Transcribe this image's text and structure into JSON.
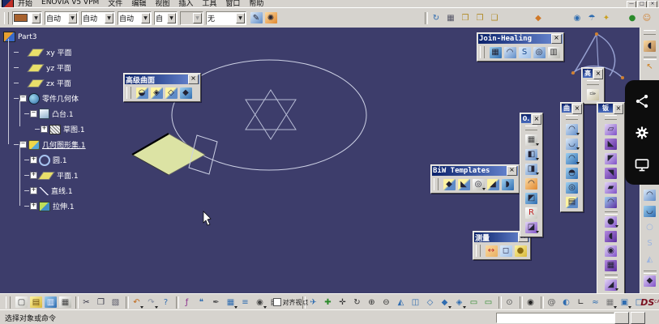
{
  "app": {
    "close_glyph": "×",
    "dropdown_glyph": "▼",
    "viewport_bg": "#3d3d6b",
    "chrome_bg": "#d6d3ce",
    "title_bar_color": "#0a216a",
    "pad_fill": "#dce3a4",
    "tree_text": "#ffffff"
  },
  "menubar": {
    "items": [
      {
        "name": "menu-start",
        "label": "开始"
      },
      {
        "name": "menu-enovia",
        "label": "ENOVIA V5 VPM"
      },
      {
        "name": "menu-file",
        "label": "文件"
      },
      {
        "name": "menu-edit",
        "label": "编辑"
      },
      {
        "name": "menu-view",
        "label": "视图"
      },
      {
        "name": "menu-insert",
        "label": "插入"
      },
      {
        "name": "menu-tools",
        "label": "工具"
      },
      {
        "name": "menu-window",
        "label": "窗口"
      },
      {
        "name": "menu-help",
        "label": "帮助"
      }
    ],
    "controls": [
      {
        "name": "minimize-button",
        "glyph": "—"
      },
      {
        "name": "maximize-button",
        "glyph": "□"
      },
      {
        "name": "close-button",
        "glyph": "×"
      }
    ]
  },
  "format_bar": {
    "combos": [
      {
        "name": "color-combo",
        "value": "",
        "size": "c",
        "swatch": "#a8622e"
      },
      {
        "name": "linetype-combo",
        "value": "自动"
      },
      {
        "name": "lineweight-combo",
        "value": "自动"
      },
      {
        "name": "pointtype-combo",
        "value": "自动"
      },
      {
        "name": "render-combo",
        "value": "自",
        "size": "s"
      },
      {
        "name": "disabled-combo",
        "value": "",
        "size": "s",
        "disabled": true
      },
      {
        "name": "layer-filter-combo",
        "value": "无",
        "size": "l"
      }
    ],
    "tools": [
      {
        "name": "paint-attributes-icon",
        "glyph": "✎",
        "bg": "linear-gradient(135deg,#dce9f8,#5f8cc8)"
      },
      {
        "name": "color-wand-icon",
        "glyph": "✺",
        "bg": "linear-gradient(135deg,#fcd9a0,#e08830)"
      }
    ],
    "right_icons": [
      {
        "name": "update-links-icon",
        "glyph": "↻",
        "fg": "#2f6cb0",
        "sep": true
      },
      {
        "name": "grid-snap-icon",
        "glyph": "▦",
        "fg": "#556"
      },
      {
        "name": "catalog-copy-icon",
        "glyph": "❒",
        "fg": "#b08820"
      },
      {
        "name": "catalog-open-icon",
        "glyph": "❐",
        "fg": "#b08820"
      },
      {
        "name": "catalog-save-icon",
        "glyph": "❑",
        "fg": "#b08820"
      },
      {
        "name": "material-basket-icon",
        "glyph": "◆",
        "fg": "#d07828",
        "ml": 36
      },
      {
        "name": "eye-icon",
        "glyph": "◉",
        "fg": "#2f6cb0",
        "ml": 30
      },
      {
        "name": "parasol-icon",
        "glyph": "☂",
        "fg": "#2f6cb0"
      },
      {
        "name": "desk-lamp-icon",
        "glyph": "✦",
        "fg": "#caa020"
      },
      {
        "name": "globe-icon",
        "glyph": "●",
        "fg": "#2a8a2a",
        "ml": 14
      },
      {
        "name": "avatar-icon",
        "glyph": "☺",
        "fg": "#d08030"
      }
    ]
  },
  "tree": {
    "items": [
      {
        "name": "tree-item-part3",
        "label": "Part3",
        "depth": 0,
        "icon": "part"
      },
      {
        "name": "tree-item-xy-plane",
        "label": "xy 平面",
        "depth": 1,
        "icon": "plane"
      },
      {
        "name": "tree-item-yz-plane",
        "label": "yz 平面",
        "depth": 1,
        "icon": "plane"
      },
      {
        "name": "tree-item-zx-plane",
        "label": "zx 平面",
        "depth": 1,
        "icon": "plane"
      },
      {
        "name": "tree-item-partbody",
        "label": "零件几何体",
        "depth": 1,
        "icon": "body",
        "exp": "minus"
      },
      {
        "name": "tree-item-pad1",
        "label": "凸台.1",
        "depth": 2,
        "icon": "pad",
        "exp": "minus"
      },
      {
        "name": "tree-item-sketch1",
        "label": "草图.1",
        "depth": 3,
        "icon": "sketch",
        "exp": "plus"
      },
      {
        "name": "tree-item-geoset1",
        "label": "几何图形集.1",
        "depth": 1,
        "icon": "geoset",
        "exp": "minus",
        "underline": true
      },
      {
        "name": "tree-item-circle1",
        "label": "圆.1",
        "depth": 2,
        "icon": "circle",
        "exp": "plus"
      },
      {
        "name": "tree-item-plane1",
        "label": "平面.1",
        "depth": 2,
        "icon": "plane",
        "exp": "plus"
      },
      {
        "name": "tree-item-line1",
        "label": "直线.1",
        "depth": 2,
        "icon": "line",
        "exp": "plus"
      },
      {
        "name": "tree-item-extrude1",
        "label": "拉伸.1",
        "depth": 2,
        "icon": "extrude",
        "exp": "plus"
      }
    ]
  },
  "toolbars": {
    "advanced_surface": {
      "title": "高级曲面",
      "icons": [
        {
          "name": "bump-surface-icon",
          "glyph": "◒",
          "bg": "linear-gradient(135deg,#fdf3a0 45%,#5f8cc8 55%)"
        },
        {
          "name": "wrap-curve-icon",
          "glyph": "◈",
          "bg": "linear-gradient(135deg,#fdf3a0 45%,#5f8cc8 55%)"
        },
        {
          "name": "wrap-surface-icon",
          "glyph": "◇",
          "bg": "linear-gradient(135deg,#fdf3a0 45%,#5f8cc8 55%)"
        },
        {
          "name": "shape-morphing-icon",
          "glyph": "◆",
          "bg": "linear-gradient(135deg,#9fd0f0,#2f6cb0)"
        }
      ]
    },
    "join_healing": {
      "title": "Join-Healing",
      "icons": [
        {
          "name": "join-icon",
          "glyph": "▦",
          "bg": "linear-gradient(135deg,#9fd0f0,#2f6cb0)"
        },
        {
          "name": "healing-icon",
          "glyph": "◠",
          "bg": "linear-gradient(135deg,#dce9f8,#5f8cc8)"
        },
        {
          "name": "curve-smooth-icon",
          "glyph": "S",
          "fg": "#1c4c90",
          "bg": "linear-gradient(135deg,#dce9f8,#9fc0e8)"
        },
        {
          "name": "untrim-icon",
          "glyph": "◎",
          "bg": "linear-gradient(135deg,#dce9f8,#5f8cc8)"
        },
        {
          "name": "disassemble-icon",
          "glyph": "▥",
          "fg": "#333",
          "bg": "linear-gradient(135deg,#ffffff,#b8b8b0)"
        }
      ]
    },
    "biw_templates": {
      "title": "BiW Templates",
      "icons": [
        {
          "name": "junction-icon",
          "glyph": "◆",
          "bg": "linear-gradient(135deg,#fdf3a0 45%,#5f8cc8 55%)"
        },
        {
          "name": "diabolo-icon",
          "glyph": "◣",
          "bg": "linear-gradient(135deg,#fdf3a0 45%,#5f8cc8 55%)"
        },
        {
          "name": "hole-icon",
          "glyph": "◎",
          "bg": "linear-gradient(135deg,#ffffff,#b8b8b0)",
          "dd": true
        },
        {
          "name": "mating-flange-icon",
          "glyph": "◢",
          "bg": "linear-gradient(135deg,#fdf3a0 45%,#5f8cc8 55%)"
        },
        {
          "name": "bead-icon",
          "glyph": "◗",
          "bg": "linear-gradient(135deg,#9fd0f0,#2f6cb0)"
        }
      ]
    },
    "measure": {
      "title": "测量",
      "icons": [
        {
          "name": "measure-between-icon",
          "glyph": "↔",
          "fg": "#c03030",
          "bg": "linear-gradient(135deg,#fcd9a0,#e8b060)"
        },
        {
          "name": "measure-item-icon",
          "glyph": "◻",
          "fg": "#335",
          "bg": "linear-gradient(135deg,#dce9f8,#9fc0e8)"
        },
        {
          "name": "measure-inertia-icon",
          "glyph": "●",
          "fg": "#8a6a10",
          "bg": "linear-gradient(135deg,#fdf3a0,#d8b83a)"
        }
      ]
    },
    "gao": {
      "title": "高",
      "icons": [
        {
          "name": "advanced-feature-icon",
          "glyph": "✑",
          "fg": "#555",
          "bg": "linear-gradient(135deg,#ffffff,#c8c0a0)"
        }
      ]
    },
    "vt0": {
      "title": "0.",
      "icons": [
        {
          "name": "wireframe-grid-icon",
          "glyph": "▦",
          "fg": "#444",
          "bg": "linear-gradient(135deg,#ffffff,#b8b8b0)",
          "dd": true
        },
        {
          "name": "paint-surface-icon",
          "glyph": "◧",
          "bg": "linear-gradient(135deg,#dce9f8,#5f8cc8)",
          "dd": true
        },
        {
          "name": "extract-solid-icon",
          "glyph": "◨",
          "bg": "linear-gradient(135deg,#dce9f8,#5f8cc8)",
          "dd": true
        },
        {
          "name": "dome-surface-icon",
          "glyph": "◠",
          "bg": "linear-gradient(135deg,#fcd9a0,#e08830)"
        },
        {
          "name": "split-trim-icon",
          "glyph": "◩",
          "bg": "linear-gradient(135deg,#9fd0f0,#2f6cb0)"
        },
        {
          "name": "radius-fillet-icon",
          "glyph": "R",
          "fg": "#c02020",
          "bg": "linear-gradient(135deg,#ffffff,#c8c8c0)"
        },
        {
          "name": "transform-surface-icon",
          "glyph": "◪",
          "bg": "linear-gradient(135deg,#e2d4f5,#8052c8)",
          "dd": true
        }
      ]
    },
    "vtq": {
      "title": "曲",
      "icons": [
        {
          "name": "sweep-surface-icon",
          "glyph": "◠",
          "bg": "linear-gradient(135deg,#dce9f8,#5f8cc8)",
          "dd": true
        },
        {
          "name": "revolve-surface-icon",
          "glyph": "◡",
          "bg": "linear-gradient(135deg,#dce9f8,#5f8cc8)",
          "dd": true
        },
        {
          "name": "offset-surface-icon",
          "glyph": "◠",
          "bg": "linear-gradient(135deg,#9fd0f0,#2f6cb0)",
          "dd": true
        },
        {
          "name": "dome-icon",
          "glyph": "◓",
          "bg": "linear-gradient(135deg,#9fd0f0,#2f6cb0)"
        },
        {
          "name": "ring-surface-icon",
          "glyph": "◎",
          "bg": "linear-gradient(135deg,#9fd0f0,#2f6cb0)"
        },
        {
          "name": "multi-section-icon",
          "glyph": "▤",
          "bg": "linear-gradient(135deg,#fdf3a0 45%,#5f8cc8 55%)"
        }
      ]
    },
    "vtb": {
      "title": "钣",
      "icons": [
        {
          "name": "wall-icon",
          "glyph": "▱",
          "bg": "linear-gradient(135deg,#e2d4f5,#8052c8)"
        },
        {
          "name": "side-wall-icon",
          "glyph": "◣",
          "bg": "linear-gradient(135deg,#b48ae0,#5c2ea0)"
        },
        {
          "name": "flange-icon",
          "glyph": "◤",
          "bg": "linear-gradient(135deg,#e2d4f5,#8052c8)"
        },
        {
          "name": "hem-icon",
          "glyph": "◥",
          "bg": "linear-gradient(135deg,#b48ae0,#5c2ea0)"
        },
        {
          "name": "swept-wall-icon",
          "glyph": "▰",
          "bg": "linear-gradient(135deg,#e2d4f5,#8052c8)"
        },
        {
          "name": "rolled-wall-icon",
          "glyph": "◠",
          "bg": "linear-gradient(135deg,#9fd0f0,#5c2ea0)"
        },
        {
          "name": "stamp-icon",
          "glyph": "●",
          "bg": "linear-gradient(135deg,#e2d4f5,#8052c8)",
          "dd": true,
          "sep": true
        },
        {
          "name": "louver-icon",
          "glyph": "◖",
          "bg": "linear-gradient(135deg,#b48ae0,#5c2ea0)"
        },
        {
          "name": "flanged-hole-icon",
          "glyph": "◉",
          "bg": "linear-gradient(135deg,#e2d4f5,#8052c8)"
        },
        {
          "name": "pattern-icon",
          "glyph": "▦",
          "bg": "linear-gradient(135deg,#b48ae0,#5c2ea0)"
        },
        {
          "name": "corner-relief-icon",
          "glyph": "◢",
          "bg": "linear-gradient(135deg,#e2d4f5,#8052c8)",
          "dd": true,
          "sep": true
        }
      ]
    },
    "right_dock": {
      "icons": [
        {
          "name": "render-tools-icon",
          "glyph": "◖",
          "bg": "linear-gradient(135deg,#fcd9a0,#b08050)"
        },
        {
          "name": "select-arrow-icon",
          "glyph": "↖",
          "fg": "#d08020",
          "sep": true
        },
        {
          "name": "dock-gap",
          "gap": 135
        },
        {
          "name": "surface-sweep-icon",
          "glyph": "◠",
          "bg": "linear-gradient(135deg,#dce9f8,#5f8cc8)"
        },
        {
          "name": "surface-loft-icon",
          "glyph": "◡",
          "bg": "linear-gradient(135deg,#9fd0f0,#2f6cb0)"
        },
        {
          "name": "circle-tool-icon",
          "glyph": "○",
          "fg": "#9ab4e0"
        },
        {
          "name": "spline-tool-icon",
          "glyph": "S",
          "fg": "#9ab4e0"
        },
        {
          "name": "plane-tool-icon",
          "glyph": "◭",
          "fg": "#9ab4e0"
        },
        {
          "name": "extrude-surface-icon",
          "glyph": "◆",
          "bg": "linear-gradient(135deg,#e2d4f5,#8052c8)",
          "sep": true
        }
      ]
    },
    "bottom": {
      "icons": [
        {
          "name": "new-document-button",
          "glyph": "▢",
          "fg": "#444",
          "bg": "linear-gradient(135deg,#ffffff,#c8c8c0)"
        },
        {
          "name": "open-button",
          "glyph": "▤",
          "fg": "#705010",
          "bg": "linear-gradient(135deg,#fdf3a0,#d8b83a)"
        },
        {
          "name": "save-button",
          "glyph": "▥",
          "fg": "#eef",
          "bg": "linear-gradient(135deg,#9fd0f0,#2f6cb0)"
        },
        {
          "name": "print-button",
          "glyph": "▦",
          "fg": "#444",
          "bg": "linear-gradient(135deg,#ffffff,#b8b8b0)"
        },
        {
          "name": "cut-button",
          "glyph": "✂",
          "fg": "#334",
          "sep": true
        },
        {
          "name": "copy-button",
          "glyph": "❐",
          "fg": "#334"
        },
        {
          "name": "paste-button",
          "glyph": "▧",
          "fg": "#556"
        },
        {
          "name": "undo-button",
          "glyph": "↶",
          "fg": "#c06818",
          "dd": true,
          "sep": true
        },
        {
          "name": "redo-button",
          "glyph": "↷",
          "fg": "#8890a0",
          "dd": true
        },
        {
          "name": "whats-this-button",
          "glyph": "?",
          "fg": "#2f6cb0"
        },
        {
          "name": "formula-button",
          "glyph": "ƒ",
          "fg": "#8a2a8a",
          "sep": true
        },
        {
          "name": "chat-button",
          "glyph": "❝",
          "fg": "#2f6cb0"
        },
        {
          "name": "knowledge-button",
          "glyph": "✒",
          "fg": "#555"
        },
        {
          "name": "design-table-button",
          "glyph": "▦",
          "fg": "#2f6cb0",
          "dd": true
        },
        {
          "name": "structure-button",
          "glyph": "≡",
          "fg": "#2f6cb0"
        },
        {
          "name": "camera-button",
          "glyph": "◉",
          "fg": "#444",
          "dd": true
        },
        {
          "name": "film-button",
          "glyph": "▤",
          "fg": "#444"
        },
        {
          "name": "align-viewpoint-checkbox",
          "type": "checkbox",
          "label": "对齐视点"
        },
        {
          "name": "fly-mode-button",
          "glyph": "✈",
          "fg": "#2f6cb0",
          "sep": true
        },
        {
          "name": "fit-all-in-button",
          "glyph": "✚",
          "fg": "#2a8a2a"
        },
        {
          "name": "pan-button",
          "glyph": "✛",
          "fg": "#333"
        },
        {
          "name": "rotate-button",
          "glyph": "↻",
          "fg": "#333"
        },
        {
          "name": "zoom-in-button",
          "glyph": "⊕",
          "fg": "#333"
        },
        {
          "name": "zoom-out-button",
          "glyph": "⊖",
          "fg": "#333"
        },
        {
          "name": "normal-view-button",
          "glyph": "◭",
          "fg": "#2f6cb0"
        },
        {
          "name": "multi-view-button",
          "glyph": "◫",
          "fg": "#2f6cb0"
        },
        {
          "name": "iso-view-button",
          "glyph": "◇",
          "fg": "#2f6cb0"
        },
        {
          "name": "shading-mode-button",
          "glyph": "◆",
          "fg": "#2f6cb0",
          "dd": true
        },
        {
          "name": "render-style-button",
          "glyph": "◈",
          "fg": "#2f6cb0",
          "dd": true
        },
        {
          "name": "screen-a-button",
          "glyph": "▭",
          "fg": "#2a8a2a"
        },
        {
          "name": "screen-b-button",
          "glyph": "▭",
          "fg": "#2a8a2a"
        },
        {
          "name": "view-lock-button",
          "glyph": "⊙",
          "fg": "#555",
          "sep": true
        },
        {
          "name": "capture-button",
          "glyph": "◉",
          "fg": "#222",
          "sep": true
        },
        {
          "name": "swirl-button",
          "glyph": "@",
          "fg": "#555",
          "sep": true
        },
        {
          "name": "globe-render-button",
          "glyph": "◐",
          "fg": "#2f6cb0"
        },
        {
          "name": "axis-system-button",
          "glyph": "∟",
          "fg": "#333"
        },
        {
          "name": "constraints-button",
          "glyph": "≈",
          "fg": "#2f6cb0"
        },
        {
          "name": "grid-button",
          "glyph": "▦",
          "fg": "#777",
          "dd": true
        },
        {
          "name": "layer-cubes-button",
          "glyph": "▣",
          "fg": "#2f6cb0",
          "dd": true
        },
        {
          "name": "cube-button",
          "glyph": "□",
          "fg": "#2f6cb0"
        },
        {
          "name": "catia-ds-logo",
          "glyph": "DS",
          "label": "CATIA",
          "logo": true
        }
      ]
    }
  },
  "overlay": {
    "icons": [
      {
        "name": "share-icon"
      },
      {
        "name": "settings-gear-icon"
      },
      {
        "name": "display-icon"
      }
    ]
  },
  "statusbar": {
    "message": "选择对象或命令",
    "input_value": "",
    "buttons": [
      {
        "name": "command-list-button",
        "glyph": "▤"
      },
      {
        "name": "help-book-button",
        "glyph": "?"
      }
    ]
  }
}
